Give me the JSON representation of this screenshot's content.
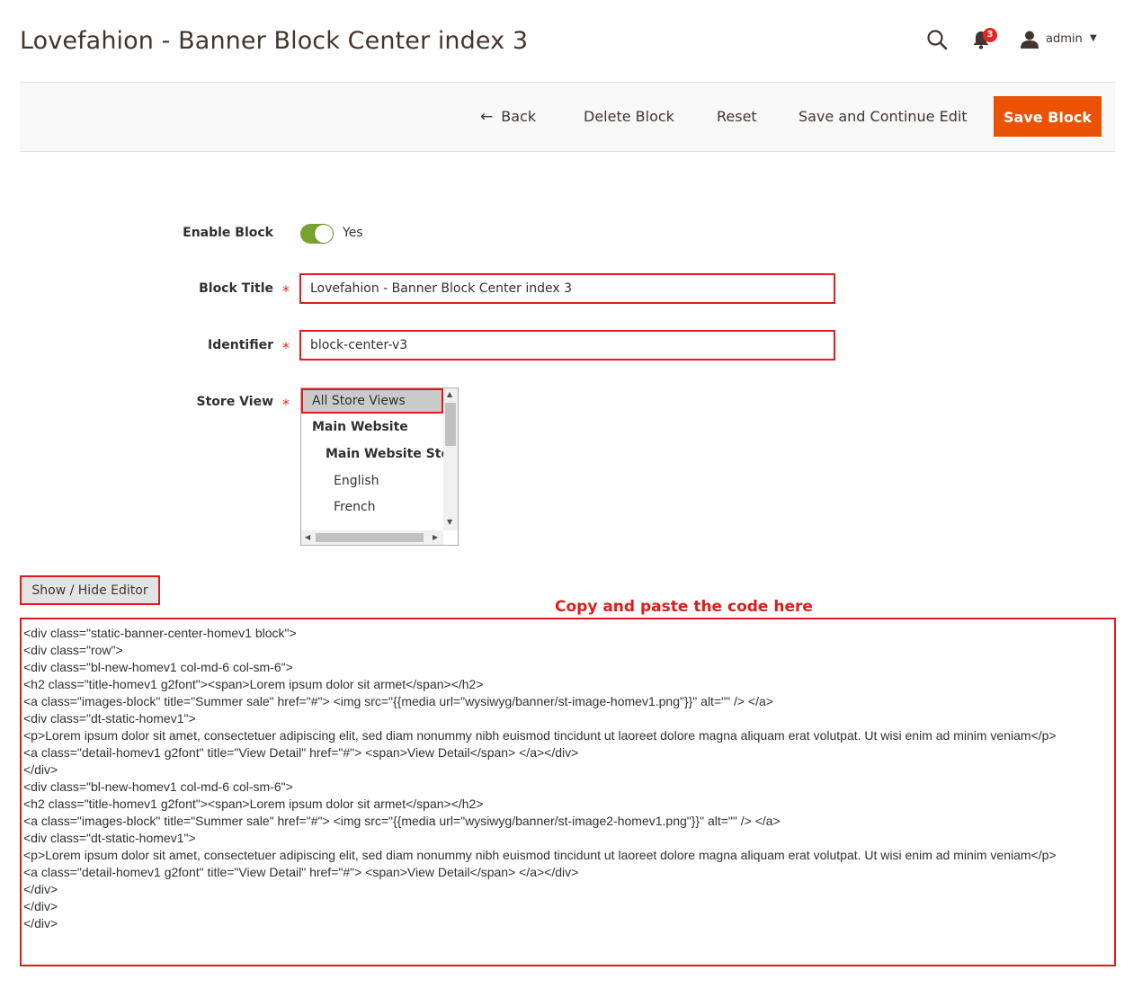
{
  "page": {
    "title": "Lovefahion - Banner Block Center index 3"
  },
  "header": {
    "notification_count": "3",
    "user_name": "admin"
  },
  "toolbar": {
    "back_label": "Back",
    "delete_label": "Delete Block",
    "reset_label": "Reset",
    "save_continue_label": "Save and Continue Edit",
    "save_label": "Save Block"
  },
  "form": {
    "enable_label": "Enable Block",
    "enable_value": "Yes",
    "title_label": "Block Title",
    "title_value": "Lovefahion - Banner Block Center index 3",
    "identifier_label": "Identifier",
    "identifier_value": "block-center-v3",
    "store_view_label": "Store View",
    "store_options": [
      "All Store Views",
      "Main Website",
      "Main Website Store",
      "English",
      "French"
    ],
    "required_mark": "*"
  },
  "editor": {
    "toggle_label": "Show / Hide Editor",
    "annotation": "Copy and paste the code here",
    "code_lines": [
      "<div class=\"static-banner-center-homev1 block\">",
      "<div class=\"row\">",
      "<div class=\"bl-new-homev1 col-md-6 col-sm-6\">",
      "<h2 class=\"title-homev1 g2font\"><span>Lorem ipsum dolor sit armet</span></h2>",
      "<a class=\"images-block\" title=\"Summer sale\" href=\"#\"> <img src=\"{{media url=\"wysiwyg/banner/st-image-homev1.png\"}}\" alt=\"\" /> </a>",
      "<div class=\"dt-static-homev1\">",
      "<p>Lorem ipsum dolor sit amet, consectetuer adipiscing elit, sed diam nonummy nibh euismod tincidunt ut laoreet dolore magna aliquam erat volutpat. Ut wisi enim ad minim veniam</p>",
      "<a class=\"detail-homev1 g2font\" title=\"View Detail\" href=\"#\"> <span>View Detail</span> </a></div>",
      "</div>",
      "<div class=\"bl-new-homev1 col-md-6 col-sm-6\">",
      "<h2 class=\"title-homev1 g2font\"><span>Lorem ipsum dolor sit armet</span></h2>",
      "<a class=\"images-block\" title=\"Summer sale\" href=\"#\"> <img src=\"{{media url=\"wysiwyg/banner/st-image2-homev1.png\"}}\" alt=\"\" /> </a>",
      "<div class=\"dt-static-homev1\">",
      "<p>Lorem ipsum dolor sit amet, consectetuer adipiscing elit, sed diam nonummy nibh euismod tincidunt ut laoreet dolore magna aliquam erat volutpat. Ut wisi enim ad minim veniam</p>",
      "<a class=\"detail-homev1 g2font\" title=\"View Detail\" href=\"#\"> <span>View Detail</span> </a></div>",
      "</div>",
      "</div>",
      "</div>"
    ]
  },
  "colors": {
    "accent": "#eb5202",
    "highlight": "#e01b1b",
    "toggle_on": "#79a22e"
  }
}
